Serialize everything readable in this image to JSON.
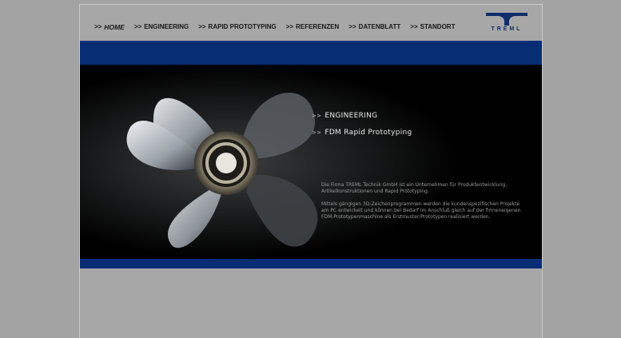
{
  "nav": {
    "items": [
      {
        "arrows": ">>",
        "label": "HOME"
      },
      {
        "arrows": ">>",
        "label": "ENGINEERING"
      },
      {
        "arrows": ">>",
        "label": "RAPID PROTOTYPING"
      },
      {
        "arrows": ">>",
        "label": "REFERENZEN"
      },
      {
        "arrows": ">>",
        "label": "DATENBLATT"
      },
      {
        "arrows": ">>",
        "label": "STANDORT"
      }
    ]
  },
  "logo": {
    "text": "TREML"
  },
  "hero": {
    "links": [
      {
        "arrows": ">>",
        "label": "ENGINEERING"
      },
      {
        "arrows": ">>",
        "label": "FDM Rapid Prototyping"
      }
    ],
    "intro": [
      "Die Firma TREML Technik GmbH ist ein Unternehmen für Produktentwicklung, Artikelkonstruktionen und Rapid Prototyping.",
      "Mittels gängigen 3D-Zeichenprogrammen werden die kundenspezifischen Projekte am PC entwickelt und können bei Bedarf im Anschluß gleich auf der firmeneigenen FDM-Prototypenmaschine als Erstmuster/Prototypen realisiert werden."
    ]
  },
  "colors": {
    "brand_blue": "#072d74",
    "page_gray": "#a7a7a7",
    "hero_bg": "#000000"
  }
}
